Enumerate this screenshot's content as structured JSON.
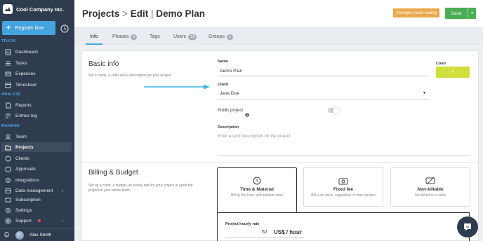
{
  "sidebar": {
    "brand": "Cool Company Inc.",
    "register_label": "Register time",
    "sections": {
      "track": "TRACK",
      "analyze": "ANALYZE",
      "manage": "MANAGE"
    },
    "items": [
      {
        "label": "Dashboard",
        "icon": "dashboard-icon"
      },
      {
        "label": "Tasks",
        "icon": "tasks-icon"
      },
      {
        "label": "Expenses",
        "icon": "expenses-icon"
      },
      {
        "label": "Timesheet",
        "icon": "timesheet-icon"
      },
      {
        "label": "Reports",
        "icon": "reports-icon"
      },
      {
        "label": "Entries log",
        "icon": "entries-log-icon"
      },
      {
        "label": "Team",
        "icon": "team-icon"
      },
      {
        "label": "Projects",
        "icon": "projects-icon",
        "active": true
      },
      {
        "label": "Clients",
        "icon": "clients-icon"
      },
      {
        "label": "Approvals",
        "icon": "approvals-icon"
      },
      {
        "label": "Integrations",
        "icon": "integrations-icon"
      },
      {
        "label": "Data management",
        "icon": "data-management-icon"
      },
      {
        "label": "Subscription",
        "icon": "subscription-icon"
      },
      {
        "label": "Settings",
        "icon": "settings-icon"
      },
      {
        "label": "Support",
        "icon": "support-icon"
      }
    ],
    "user_name": "Alex Smith"
  },
  "header": {
    "title_part1": "Projects",
    "title_sep": ">",
    "title_part2": "Edit",
    "title_bar": "|",
    "title_part3": "Demo Plan",
    "changes_badge": "Changes need saving",
    "save_label": "Save"
  },
  "tabs": [
    {
      "label": "Info",
      "count": null
    },
    {
      "label": "Phases",
      "count": "6"
    },
    {
      "label": "Tags",
      "count": null
    },
    {
      "label": "Users",
      "count": "12"
    },
    {
      "label": "Groups",
      "count": "1"
    }
  ],
  "basic_info": {
    "title": "Basic info",
    "description": "Set a name, a color and a description for your project.",
    "name_label": "Name",
    "name_value": "Demo Plan",
    "color_label": "Color",
    "color_value": "#cfdf3c",
    "client_label": "Client",
    "client_value": "Jane Doe",
    "public_label": "Public project",
    "public_enabled": false,
    "description_label": "Description",
    "description_placeholder": "Enter a short description for the project"
  },
  "billing": {
    "title": "Billing & Budget",
    "description_line1": "Set up a client, a budget, an hourly rate for your project or open the",
    "description_line2": "project to your whole team.",
    "cards": [
      {
        "name": "Time & Material",
        "desc": "Bill by the hour, with billable rates",
        "icon": "clock-icon",
        "selected": true
      },
      {
        "name": "Fixed fee",
        "desc": "Bill a set price, regardless of time tracked",
        "icon": "money-icon",
        "selected": false
      },
      {
        "name": "Non-billable",
        "desc": "Not billed to a client",
        "icon": "no-money-icon",
        "selected": false
      }
    ],
    "rate_label": "Project hourly rate",
    "rate_value": "52",
    "rate_unit": "US$ / hour"
  }
}
